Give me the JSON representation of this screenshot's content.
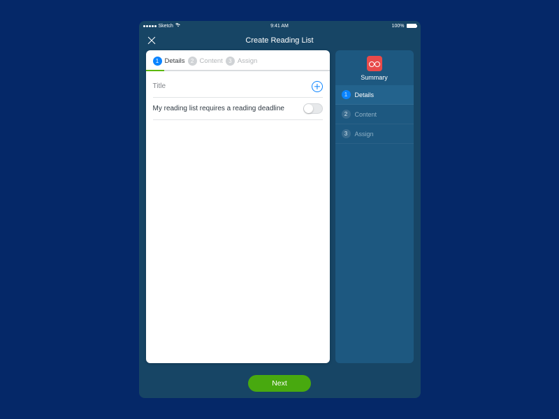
{
  "status": {
    "carrier": "Sketch",
    "time": "9:41 AM",
    "battery_pct": "100%"
  },
  "nav": {
    "title": "Create Reading List"
  },
  "steps": [
    {
      "num": "1",
      "label": "Details",
      "active": true
    },
    {
      "num": "2",
      "label": "Content",
      "active": false
    },
    {
      "num": "3",
      "label": "Assign",
      "active": false
    }
  ],
  "form": {
    "title_label": "Title",
    "deadline_label": "My reading list requires a reading deadline",
    "deadline_on": false
  },
  "summary": {
    "title": "Summary",
    "items": [
      {
        "num": "1",
        "label": "Details",
        "active": true
      },
      {
        "num": "2",
        "label": "Content",
        "active": false
      },
      {
        "num": "3",
        "label": "Assign",
        "active": false
      }
    ]
  },
  "footer": {
    "next_label": "Next"
  },
  "colors": {
    "accent": "#0a84ff",
    "progress": "#5cb800",
    "bg_page": "#052868",
    "bg_tablet": "#174565",
    "bg_summary": "#1d5880",
    "danger": "#e84a4a"
  }
}
